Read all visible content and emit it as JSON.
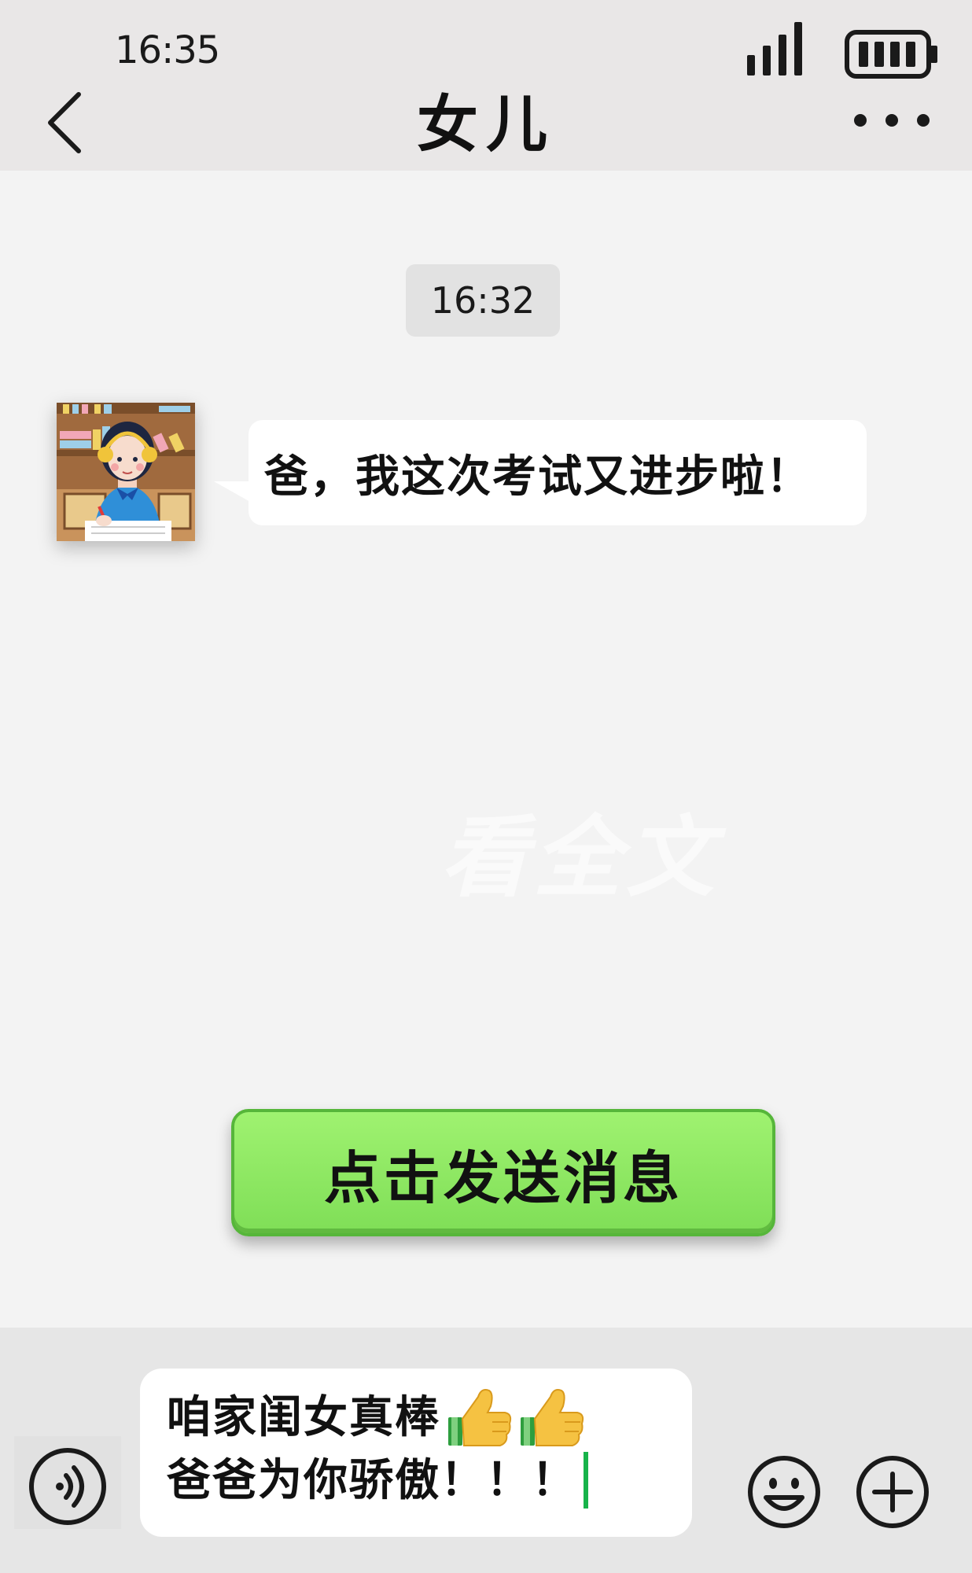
{
  "status_bar": {
    "time": "16:35",
    "signal_icon": "signal-bars-icon",
    "battery_icon": "battery-icon"
  },
  "header": {
    "title": "女儿",
    "back_icon": "chevron-left-icon",
    "more_icon": "more-dots-icon"
  },
  "chat": {
    "timestamp": "16:32",
    "messages": [
      {
        "sender": "daughter",
        "avatar_icon": "girl-studying-avatar",
        "text": "爸，我这次考试又进步啦！"
      }
    ],
    "watermark": "看全文"
  },
  "send_button": {
    "label": "点击发送消息",
    "color": "#8de866"
  },
  "input": {
    "line1": "咱家闺女真棒",
    "line2": "爸爸为你骄傲！！！",
    "emoji": "thumbs-up-icon",
    "cursor_color": "#17b34a"
  },
  "toolbar": {
    "voice_icon": "voice-icon",
    "emoji_icon": "smiley-icon",
    "plus_icon": "plus-icon"
  }
}
